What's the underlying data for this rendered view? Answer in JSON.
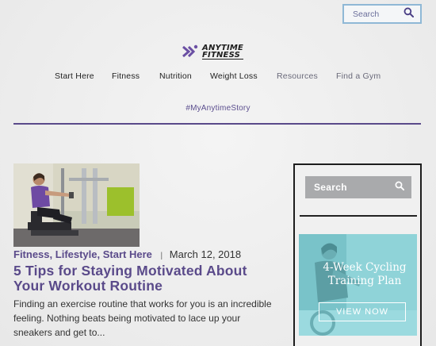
{
  "header": {
    "search_placeholder": "Search",
    "logo": {
      "line1": "ANYTIME",
      "line2": "FITNESS"
    }
  },
  "nav": {
    "items": [
      {
        "label": "Start Here"
      },
      {
        "label": "Fitness"
      },
      {
        "label": "Nutrition"
      },
      {
        "label": "Weight Loss"
      },
      {
        "label": "Resources"
      },
      {
        "label": "Find a Gym"
      }
    ],
    "hashtag": "#MyAnytimeStory"
  },
  "article": {
    "categories": [
      "Fitness",
      "Lifestyle",
      "Start Here"
    ],
    "cat_separator": ",",
    "meta_separator": "|",
    "date": "March 12, 2018",
    "title": "5 Tips for Staying Motivated About Your Workout Routine",
    "excerpt": "Finding an exercise routine that works for you is an incredible feeling. Nothing beats being motivated to lace up your sneakers and get to..."
  },
  "sidebar": {
    "search_placeholder": "Search",
    "promo": {
      "title": "4-Week Cycling Training Plan",
      "button": "VIEW NOW"
    }
  },
  "colors": {
    "brand_purple": "#5a4a8a",
    "search_border": "#8fb8d6",
    "promo_teal": "#8fd3d8"
  }
}
